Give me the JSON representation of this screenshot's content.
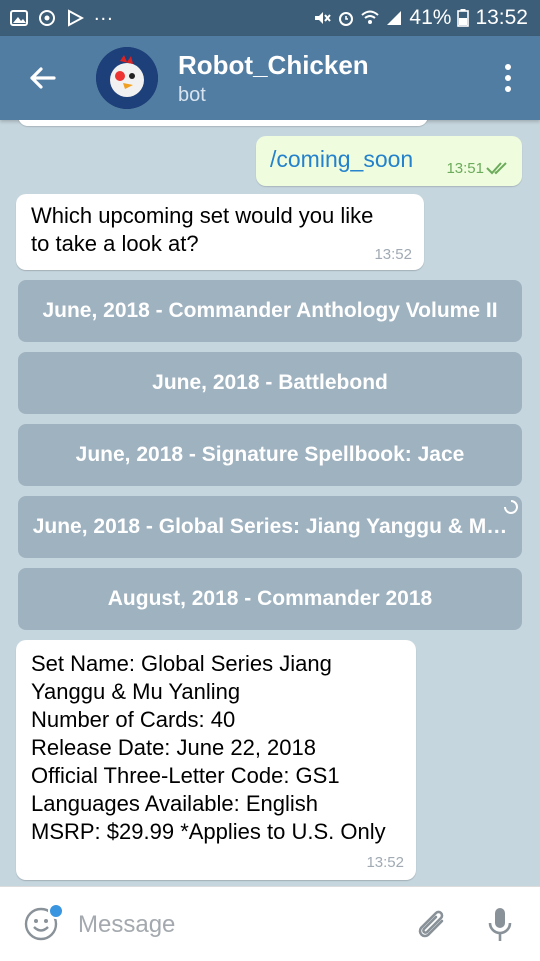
{
  "status_bar": {
    "battery": "41%",
    "time": "13:52",
    "dots": "...",
    "icons": [
      "image-icon",
      "whatsapp-icon",
      "play-store-icon",
      "mute-icon",
      "alarm-icon",
      "wifi-icon",
      "signal-icon",
      "battery-icon"
    ]
  },
  "header": {
    "title": "Robot_Chicken",
    "subtitle": "bot",
    "accent": "#527da3"
  },
  "messages": {
    "outgoing": {
      "text": "/coming_soon",
      "time": "13:51"
    },
    "question": {
      "text": "Which upcoming set would you like\nto take a look at?",
      "time": "13:52"
    },
    "info": {
      "text": "Set Name: Global Series Jiang\nYanggu & Mu Yanling\nNumber of Cards: 40\nRelease Date: June 22, 2018\nOfficial Three-Letter Code: GS1\nLanguages Available: English\nMSRP: $29.99 *Applies to U.S. Only",
      "time": "13:52"
    }
  },
  "keyboard": {
    "buttons": [
      "June, 2018 - Commander Anthology Volume II",
      "June, 2018 - Battlebond",
      "June, 2018 - Signature Spellbook: Jace",
      "June, 2018 - Global Series: Jiang Yanggu & M…",
      "August, 2018 - Commander 2018"
    ]
  },
  "input": {
    "placeholder": "Message"
  }
}
